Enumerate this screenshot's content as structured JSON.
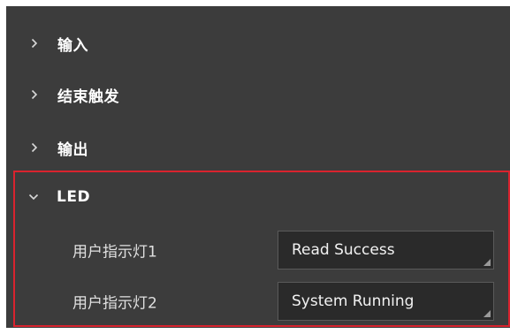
{
  "sections": [
    {
      "label": "输入",
      "expanded": false,
      "icon": "chevron-right-icon"
    },
    {
      "label": "结束触发",
      "expanded": false,
      "icon": "chevron-right-icon"
    },
    {
      "label": "输出",
      "expanded": false,
      "icon": "chevron-right-icon"
    },
    {
      "label": "LED",
      "expanded": true,
      "icon": "chevron-down-icon"
    }
  ],
  "led": {
    "fields": [
      {
        "label": "用户指示灯1",
        "value": "Read Success"
      },
      {
        "label": "用户指示灯2",
        "value": "System Running"
      }
    ]
  },
  "colors": {
    "panel_bg": "#3c3c3c",
    "highlight_border": "#d9232e",
    "select_bg": "#2a2a2a"
  }
}
